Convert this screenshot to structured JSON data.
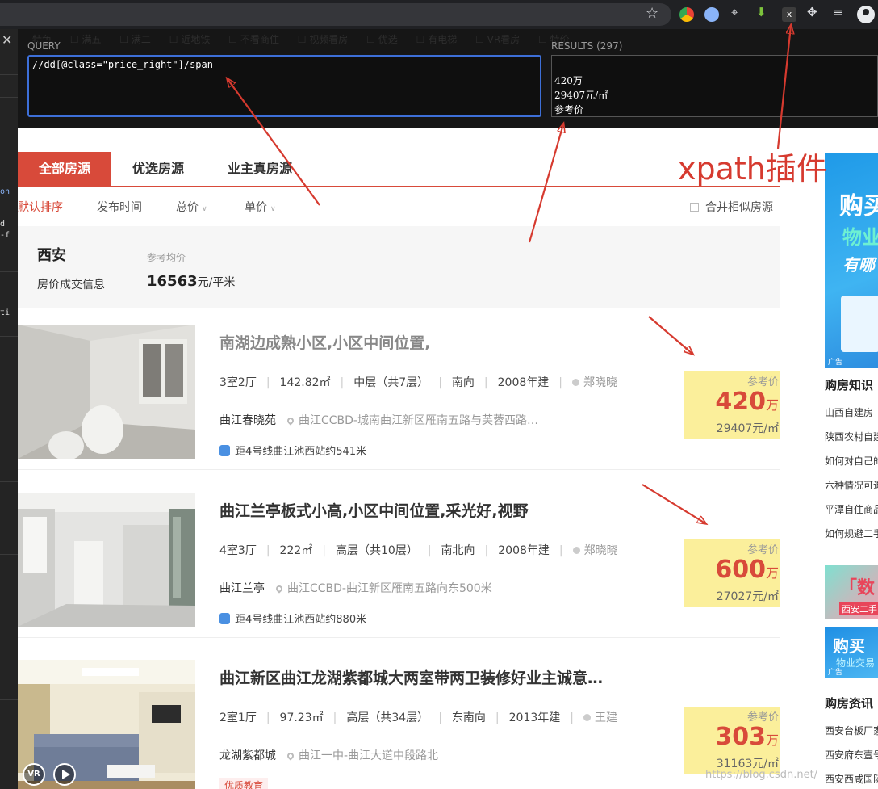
{
  "xpath": {
    "query_label": "QUERY",
    "query": "//dd[@class=\"price_right\"]/span",
    "results_label": "RESULTS (297)",
    "results": [
      "420万",
      "29407元/㎡",
      "参考价"
    ]
  },
  "tabs": [
    "全部房源",
    "优选房源",
    "业主真房源"
  ],
  "sort": {
    "items": [
      "默认排序",
      "发布时间",
      "总价",
      "单价"
    ],
    "merge_label": "合并相似房源"
  },
  "avg": {
    "city": "西安",
    "sub": "房价成交信息",
    "label": "参考均价",
    "value": "16563",
    "unit": "元/平米"
  },
  "listings": [
    {
      "title": "南湖边成熟小区,小区中间位置,",
      "rooms": "3室2厅",
      "area": "142.82㎡",
      "floor": "中层（共7层）",
      "facing": "南向",
      "year": "2008年建",
      "agent": "郑晓晓",
      "community": "曲江春晓苑",
      "address": "曲江CCBD-城南曲江新区雁南五路与芙蓉西路…",
      "metro": "距4号线曲江池西站约541米",
      "price_label": "参考价",
      "price": "420",
      "price_unit": "万",
      "unit_price": "29407元/㎡"
    },
    {
      "title": "曲江兰亭板式小高,小区中间位置,采光好,视野",
      "rooms": "4室3厅",
      "area": "222㎡",
      "floor": "高层（共10层）",
      "facing": "南北向",
      "year": "2008年建",
      "agent": "郑晓晓",
      "community": "曲江兰亭",
      "address": "曲江CCBD-曲江新区雁南五路向东500米",
      "metro": "距4号线曲江池西站约880米",
      "price_label": "参考价",
      "price": "600",
      "price_unit": "万",
      "unit_price": "27027元/㎡"
    },
    {
      "title": "曲江新区曲江龙湖紫都城大两室带两卫装修好业主诚意…",
      "rooms": "2室1厅",
      "area": "97.23㎡",
      "floor": "高层（共34层）",
      "facing": "东南向",
      "year": "2013年建",
      "agent": "王建",
      "community": "龙湖紫都城",
      "address": "曲江一中-曲江大道中段路北",
      "tag": "优质教育",
      "price_label": "参考价",
      "price": "303",
      "price_unit": "万",
      "unit_price": "31163元/㎡"
    }
  ],
  "sidebar": {
    "ad1": [
      "购买",
      "物业",
      "有哪"
    ],
    "ad_label": "广告",
    "knowledge_title": "购房知识",
    "knowledge_items": [
      "山西自建房",
      "陕西农村自建",
      "如何对自己的",
      "六种情况可退",
      "平潭自住商品",
      "如何规避二手"
    ],
    "ad2": [
      "「数",
      "西安二手"
    ],
    "ad3": [
      "购买",
      "物业交易"
    ],
    "news_title": "购房资讯",
    "news_items": [
      "西安台板厂家",
      "西安府东壹号",
      "西安西咸国际"
    ]
  },
  "annotation": "xpath插件",
  "watermark": "https://blog.csdn.net/",
  "vr_label": "VR",
  "colors": {
    "accent": "#d84a3a",
    "price_bg": "#fbef9b",
    "xpath_border": "#3d6fd8"
  }
}
